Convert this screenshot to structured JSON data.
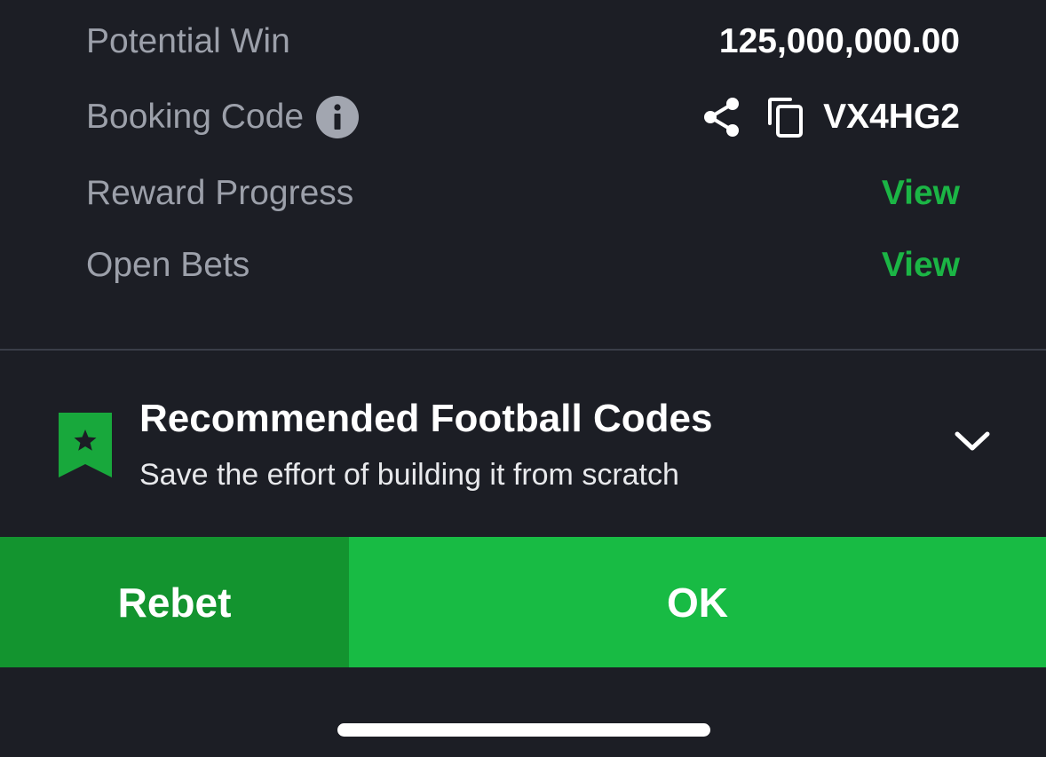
{
  "summary": {
    "potential_win": {
      "label": "Potential Win",
      "value": "125,000,000.00"
    },
    "booking_code": {
      "label": "Booking Code",
      "value": "VX4HG2",
      "info_icon": "info-icon",
      "share_icon": "share-icon",
      "copy_icon": "copy-icon"
    },
    "reward_progress": {
      "label": "Reward Progress",
      "link": "View"
    },
    "open_bets": {
      "label": "Open Bets",
      "link": "View"
    }
  },
  "recommended": {
    "title": "Recommended Football Codes",
    "subtitle": "Save the effort of building it from scratch",
    "icon": "bookmark-star-icon",
    "chevron": "chevron-down-icon"
  },
  "actions": {
    "rebet_label": "Rebet",
    "ok_label": "OK"
  },
  "colors": {
    "background": "#1c1e25",
    "label_gray": "#9ca0aa",
    "accent_green": "#1bb545",
    "rebet_green": "#13942f",
    "ok_green": "#18bb44"
  }
}
